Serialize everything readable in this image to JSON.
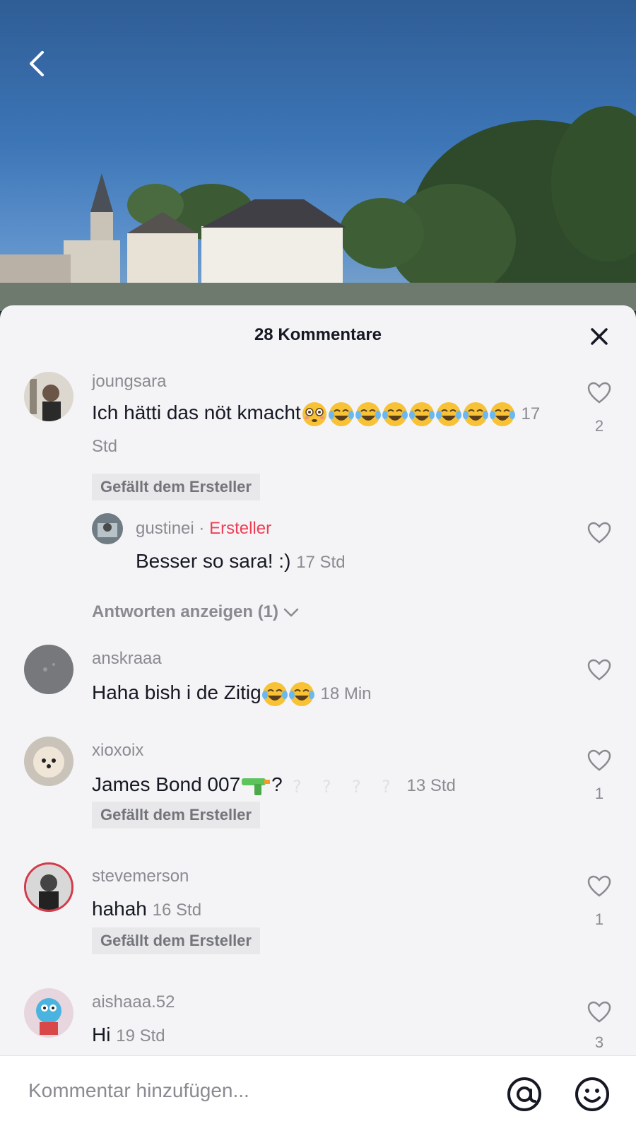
{
  "header": {
    "title": "28 Kommentare"
  },
  "comments": [
    {
      "user": "joungsara",
      "text": "Ich hätti das nöt kmacht",
      "time": "17 Std",
      "liked": "Gefällt dem Ersteller",
      "likes": "2"
    },
    {
      "user": "gustinei",
      "sep": "·",
      "badge": "Ersteller",
      "text": "Besser so sara! :)",
      "time": "17 Std"
    },
    {
      "view_replies": "Antworten anzeigen (1)"
    },
    {
      "user": "anskraaa",
      "text": "Haha bish i de Zitig",
      "time": "18 Min"
    },
    {
      "user": "xioxoix",
      "text": "James Bond 007",
      "text_suffix": "?",
      "time": "13 Std",
      "liked": "Gefällt dem Ersteller",
      "likes": "1"
    },
    {
      "user": "stevemerson",
      "text": "hahah",
      "time": "16 Std",
      "liked": "Gefällt dem Ersteller",
      "likes": "1"
    },
    {
      "user": "aishaaa.52",
      "text": "Hi",
      "time": "19 Std",
      "likes": "3"
    }
  ],
  "composer": {
    "placeholder": "Kommentar hinzufügen..."
  },
  "icons": {
    "back": "chevron-left-icon",
    "close": "close-icon",
    "heart": "heart-outline-icon",
    "at": "at-icon",
    "emoji": "emoji-icon",
    "laugh": "laughing-emoji-icon",
    "flushed": "flushed-emoji-icon",
    "gun": "water-pistol-emoji-icon"
  },
  "colors": {
    "creator": "#ee3e56",
    "sheet": "#f4f4f6",
    "text": "#161823",
    "muted": "#8a8b91"
  }
}
